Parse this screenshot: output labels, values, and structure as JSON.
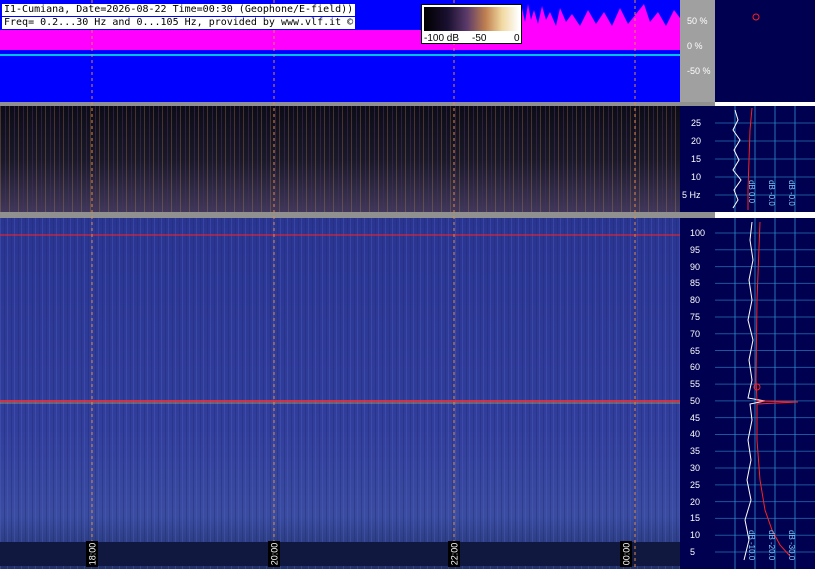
{
  "header": {
    "line1": "I1-Cumiana, Date=2026-08-22 Time=00:30 (Geophone/E-field))",
    "line2": "Freq= 0.2...30 Hz and 0...105 Hz, provided by www.vlf.it ©"
  },
  "legend": {
    "labels": [
      "-100 dB",
      "-50",
      "0"
    ]
  },
  "amplitude_axis": [
    "50 %",
    "0 %",
    "-50 %"
  ],
  "low_freq_axis": [
    "25",
    "20",
    "15",
    "10",
    "5 Hz"
  ],
  "high_freq_axis": [
    "100",
    "95",
    "90",
    "85",
    "80",
    "75",
    "70",
    "65",
    "60",
    "55",
    "50",
    "45",
    "40",
    "35",
    "30",
    "25",
    "20",
    "15",
    "10",
    "5"
  ],
  "time_labels": [
    "18:00",
    "20:00",
    "22:00",
    "00:00"
  ],
  "side_panel_labels": {
    "upper": [
      "dB 0.0",
      "dB -0.0",
      "dB -0.0"
    ],
    "lower": [
      "dB -10.0",
      "dB -20.0",
      "dB -30.0"
    ]
  },
  "colors": {
    "magenta": "#ff00ff",
    "blue": "#0000ff",
    "navy": "#000050",
    "red": "#ff2020",
    "orange_dash": "#e08a40",
    "cyan": "#00ffff"
  }
}
